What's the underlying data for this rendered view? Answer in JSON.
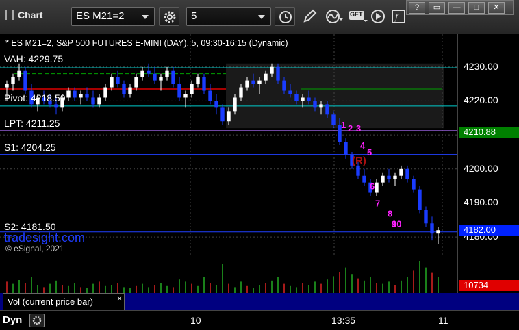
{
  "window": {
    "title": "Chart",
    "symbol": "ES M21=2",
    "interval": "5",
    "controls": {
      "help": "?",
      "restore": "▭",
      "minimize": "—",
      "maximize": "□",
      "close": "✕"
    }
  },
  "toolbar": {
    "settings_icon": "gear-icon",
    "clock_icon": "clock-icon",
    "draw_icon": "pencil-icon",
    "study_icon": "curve-icon",
    "get_label": "GET",
    "play_icon": "play-icon",
    "studies_icon": "function-icon"
  },
  "chart": {
    "header": "* ES M21=2, S&P 500 FUTURES E-MINI (DAY), 5, 09:30-16:15 (Dynamic)",
    "levels": [
      {
        "name": "VAH",
        "label": "VAH: 4229.75",
        "price": 4229.75,
        "color": "#00cccc"
      },
      {
        "name": "Pivot",
        "label": "Pivot: 4218.50",
        "price": 4218.5,
        "color": "#00cccc"
      },
      {
        "name": "LPT",
        "label": "LPT: 4211.25",
        "price": 4211.25,
        "color": "#b070ff"
      },
      {
        "name": "S1",
        "label": "S1: 4204.25",
        "price": 4204.25,
        "color": "#2040ff"
      },
      {
        "name": "S2",
        "label": "S2: 4181.50",
        "price": 4181.5,
        "color": "#2040ff"
      }
    ],
    "watermark": "tradesight.com",
    "copyright": "© eSignal, 2021",
    "price_ticks": [
      "4230.00",
      "4220.00",
      "4210.00",
      "4200.00",
      "4190.00",
      "4180.00"
    ],
    "price_tags": [
      {
        "label": "4210.88",
        "price": 4210.88,
        "bg": "#008000"
      },
      {
        "label": "4182.00",
        "price": 4182.0,
        "bg": "#0022ff"
      }
    ],
    "seq_labels": [
      "1",
      "2",
      "3",
      "4",
      "5",
      "6",
      "7",
      "8",
      "9",
      "10"
    ],
    "reversal_label": "(R)"
  },
  "chart_data": {
    "type": "candlestick",
    "ylim": [
      4175,
      4238
    ],
    "price_ticks": [
      4230,
      4220,
      4210,
      4200,
      4190,
      4180
    ],
    "candles": [
      [
        4224,
        4226,
        4220,
        4225
      ],
      [
        4225,
        4228,
        4223,
        4227
      ],
      [
        4227,
        4231,
        4226,
        4229
      ],
      [
        4229,
        4230,
        4222,
        4223
      ],
      [
        4223,
        4225,
        4218,
        4219
      ],
      [
        4219,
        4222,
        4217,
        4221
      ],
      [
        4221,
        4223,
        4219,
        4220
      ],
      [
        4220,
        4222,
        4218,
        4219
      ],
      [
        4219,
        4221,
        4216,
        4218
      ],
      [
        4218,
        4222,
        4217,
        4221
      ],
      [
        4221,
        4224,
        4220,
        4223
      ],
      [
        4223,
        4224,
        4220,
        4221
      ],
      [
        4221,
        4223,
        4219,
        4222
      ],
      [
        4222,
        4224,
        4220,
        4221
      ],
      [
        4221,
        4223,
        4218,
        4219
      ],
      [
        4219,
        4222,
        4218,
        4221
      ],
      [
        4221,
        4225,
        4220,
        4224
      ],
      [
        4224,
        4228,
        4223,
        4227
      ],
      [
        4227,
        4229,
        4224,
        4225
      ],
      [
        4225,
        4226,
        4221,
        4222
      ],
      [
        4222,
        4225,
        4221,
        4224
      ],
      [
        4224,
        4228,
        4223,
        4227
      ],
      [
        4227,
        4230,
        4226,
        4229
      ],
      [
        4229,
        4231,
        4227,
        4228
      ],
      [
        4228,
        4230,
        4225,
        4226
      ],
      [
        4226,
        4228,
        4223,
        4227
      ],
      [
        4227,
        4230,
        4226,
        4229
      ],
      [
        4229,
        4230,
        4224,
        4225
      ],
      [
        4225,
        4227,
        4220,
        4221
      ],
      [
        4221,
        4223,
        4218,
        4222
      ],
      [
        4222,
        4226,
        4221,
        4225
      ],
      [
        4225,
        4228,
        4224,
        4227
      ],
      [
        4227,
        4228,
        4222,
        4223
      ],
      [
        4223,
        4225,
        4219,
        4220
      ],
      [
        4220,
        4222,
        4216,
        4218
      ],
      [
        4218,
        4219,
        4213,
        4214
      ],
      [
        4214,
        4218,
        4213,
        4217
      ],
      [
        4217,
        4222,
        4216,
        4221
      ],
      [
        4221,
        4225,
        4220,
        4224
      ],
      [
        4224,
        4227,
        4223,
        4226
      ],
      [
        4226,
        4228,
        4224,
        4225
      ],
      [
        4225,
        4227,
        4222,
        4226
      ],
      [
        4226,
        4229,
        4225,
        4228
      ],
      [
        4228,
        4231,
        4227,
        4230
      ],
      [
        4230,
        4231,
        4225,
        4226
      ],
      [
        4226,
        4227,
        4222,
        4223
      ],
      [
        4223,
        4225,
        4221,
        4222
      ],
      [
        4222,
        4223,
        4219,
        4220
      ],
      [
        4220,
        4222,
        4218,
        4221
      ],
      [
        4221,
        4223,
        4219,
        4220
      ],
      [
        4220,
        4221,
        4217,
        4218
      ],
      [
        4218,
        4220,
        4216,
        4219
      ],
      [
        4219,
        4220,
        4215,
        4216
      ],
      [
        4216,
        4217,
        4212,
        4213
      ],
      [
        4213,
        4215,
        4207,
        4208
      ],
      [
        4208,
        4209,
        4203,
        4204
      ],
      [
        4204,
        4205,
        4200,
        4201
      ],
      [
        4201,
        4202,
        4197,
        4198
      ],
      [
        4198,
        4200,
        4195,
        4196
      ],
      [
        4196,
        4197,
        4192,
        4193
      ],
      [
        4193,
        4197,
        4192,
        4196
      ],
      [
        4196,
        4199,
        4195,
        4198
      ],
      [
        4198,
        4200,
        4196,
        4197
      ],
      [
        4197,
        4199,
        4195,
        4198
      ],
      [
        4198,
        4201,
        4197,
        4200
      ],
      [
        4200,
        4201,
        4196,
        4197
      ],
      [
        4197,
        4198,
        4193,
        4194
      ],
      [
        4194,
        4195,
        4187,
        4188
      ],
      [
        4188,
        4189,
        4183,
        4184
      ],
      [
        4184,
        4186,
        4179,
        4181
      ],
      [
        4181,
        4183,
        4178,
        4182
      ]
    ],
    "volume": [
      22,
      18,
      25,
      20,
      30,
      15,
      12,
      18,
      24,
      16,
      14,
      20,
      12,
      10,
      18,
      22,
      14,
      16,
      20,
      12,
      10,
      14,
      18,
      12,
      16,
      20,
      14,
      12,
      26,
      22,
      18,
      14,
      30,
      20,
      16,
      55,
      18,
      12,
      22,
      14,
      10,
      16,
      20,
      24,
      30,
      18,
      14,
      12,
      20,
      16,
      22,
      18,
      26,
      32,
      40,
      48,
      36,
      28,
      24,
      30,
      20,
      18,
      22,
      16,
      24,
      30,
      42,
      60,
      48,
      38,
      30
    ]
  },
  "volume_pane": {
    "legend": "Vol (current price bar)",
    "close": "×",
    "value_tag": "10734"
  },
  "time_axis": {
    "dyn_label": "Dyn",
    "labels": [
      "10",
      "13:35",
      "11"
    ]
  }
}
